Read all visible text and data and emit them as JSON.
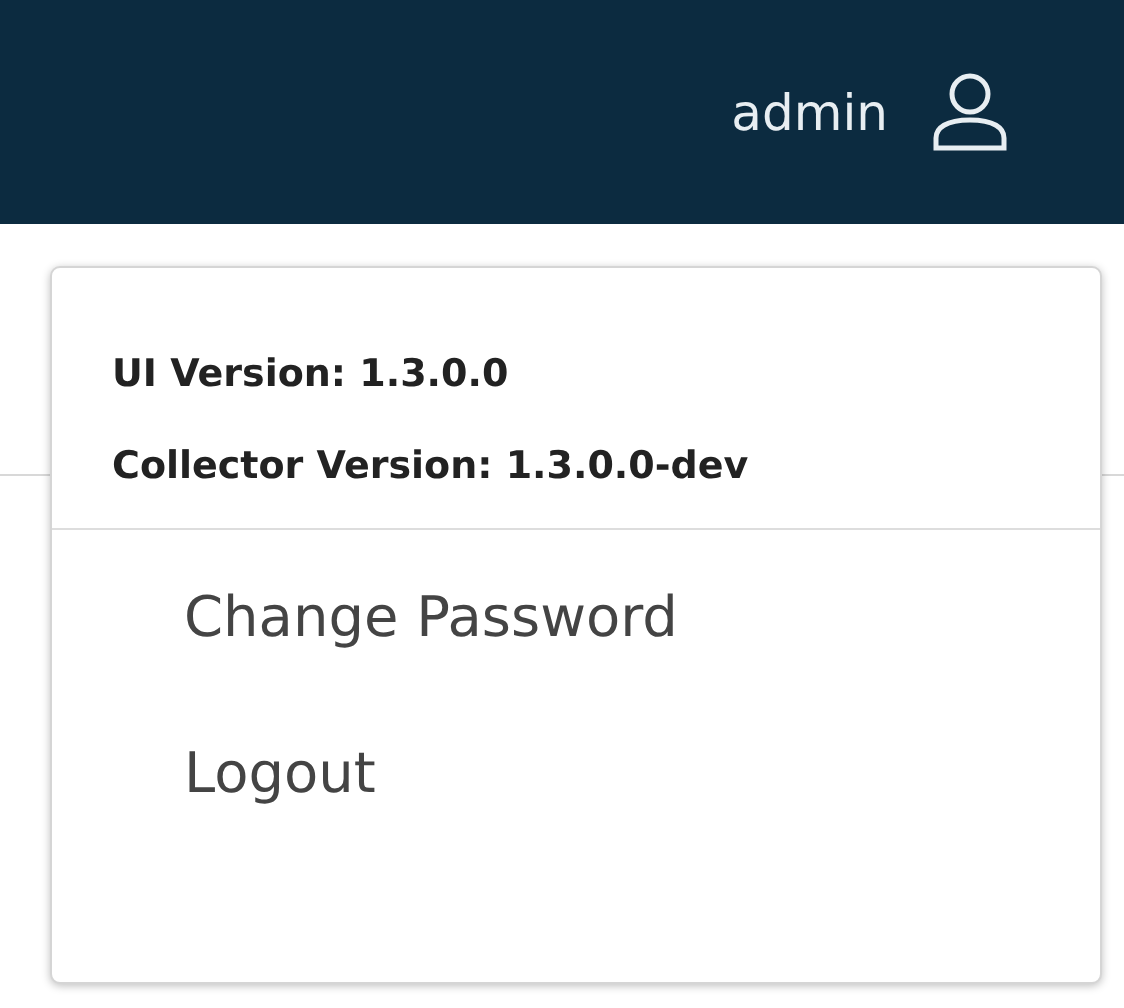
{
  "header": {
    "username": "admin"
  },
  "user_menu": {
    "info": [
      "UI Version: 1.3.0.0",
      "Collector Version: 1.3.0.0-dev"
    ],
    "items": [
      "Change Password",
      "Logout"
    ]
  }
}
